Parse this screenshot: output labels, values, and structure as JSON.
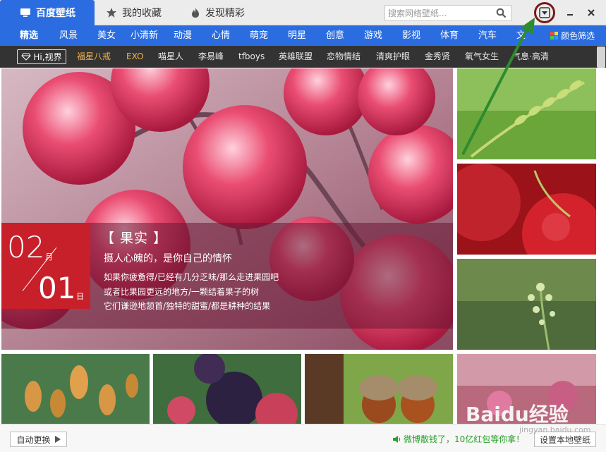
{
  "title_tabs": [
    {
      "label": "百度壁纸",
      "icon": "monitor-icon",
      "active": true
    },
    {
      "label": "我的收藏",
      "icon": "star-icon",
      "active": false
    },
    {
      "label": "发现精彩",
      "icon": "flame-icon",
      "active": false
    }
  ],
  "search": {
    "placeholder": "搜索网络壁纸..."
  },
  "categories": [
    "精选",
    "风景",
    "美女",
    "小清新",
    "动漫",
    "心情",
    "萌宠",
    "明星",
    "创意",
    "游戏",
    "影视",
    "体育",
    "汽车",
    "文"
  ],
  "color_filter_label": "颜色筛选",
  "hi_badge_label": "Hi,视界",
  "tags": [
    {
      "label": "福星八戒",
      "hot": true
    },
    {
      "label": "EXO",
      "hot": true
    },
    {
      "label": "喵星人",
      "hot": false
    },
    {
      "label": "李易峰",
      "hot": false
    },
    {
      "label": "tfboys",
      "hot": false
    },
    {
      "label": "英雄联盟",
      "hot": false
    },
    {
      "label": "恋物情结",
      "hot": false
    },
    {
      "label": "清爽护眼",
      "hot": false
    },
    {
      "label": "金秀贤",
      "hot": false
    },
    {
      "label": "氧气女生",
      "hot": false
    },
    {
      "label": "气息·高清",
      "hot": false
    }
  ],
  "feature": {
    "month": "02",
    "month_unit": "月",
    "day": "01",
    "day_unit": "日",
    "title": "【 果实 】",
    "subtitle": "摄人心魄的，是你自己的情怀",
    "lines": [
      "如果你疲惫得/已经有几分乏味/那么走进果园吧",
      "或者比果园更远的地方/一颗结着果子的树",
      "它们谦逊地颔首/独特的甜蜜/都是耕种的结果"
    ]
  },
  "footer": {
    "auto_change_label": "自动更换",
    "promo_text": "微博散钱了，10亿红包等你拿！",
    "set_local_label": "设置本地壁纸"
  },
  "watermark": {
    "text": "Baidu经验",
    "url": "jingyan.baidu.com"
  },
  "colors": {
    "brand_blue": "#2b6de0",
    "tag_bar": "#333333",
    "date_red": "#c8202a",
    "promo_green": "#28a029",
    "annotation_ring": "#7a1919",
    "annotation_arrow": "#2e8b2e"
  }
}
